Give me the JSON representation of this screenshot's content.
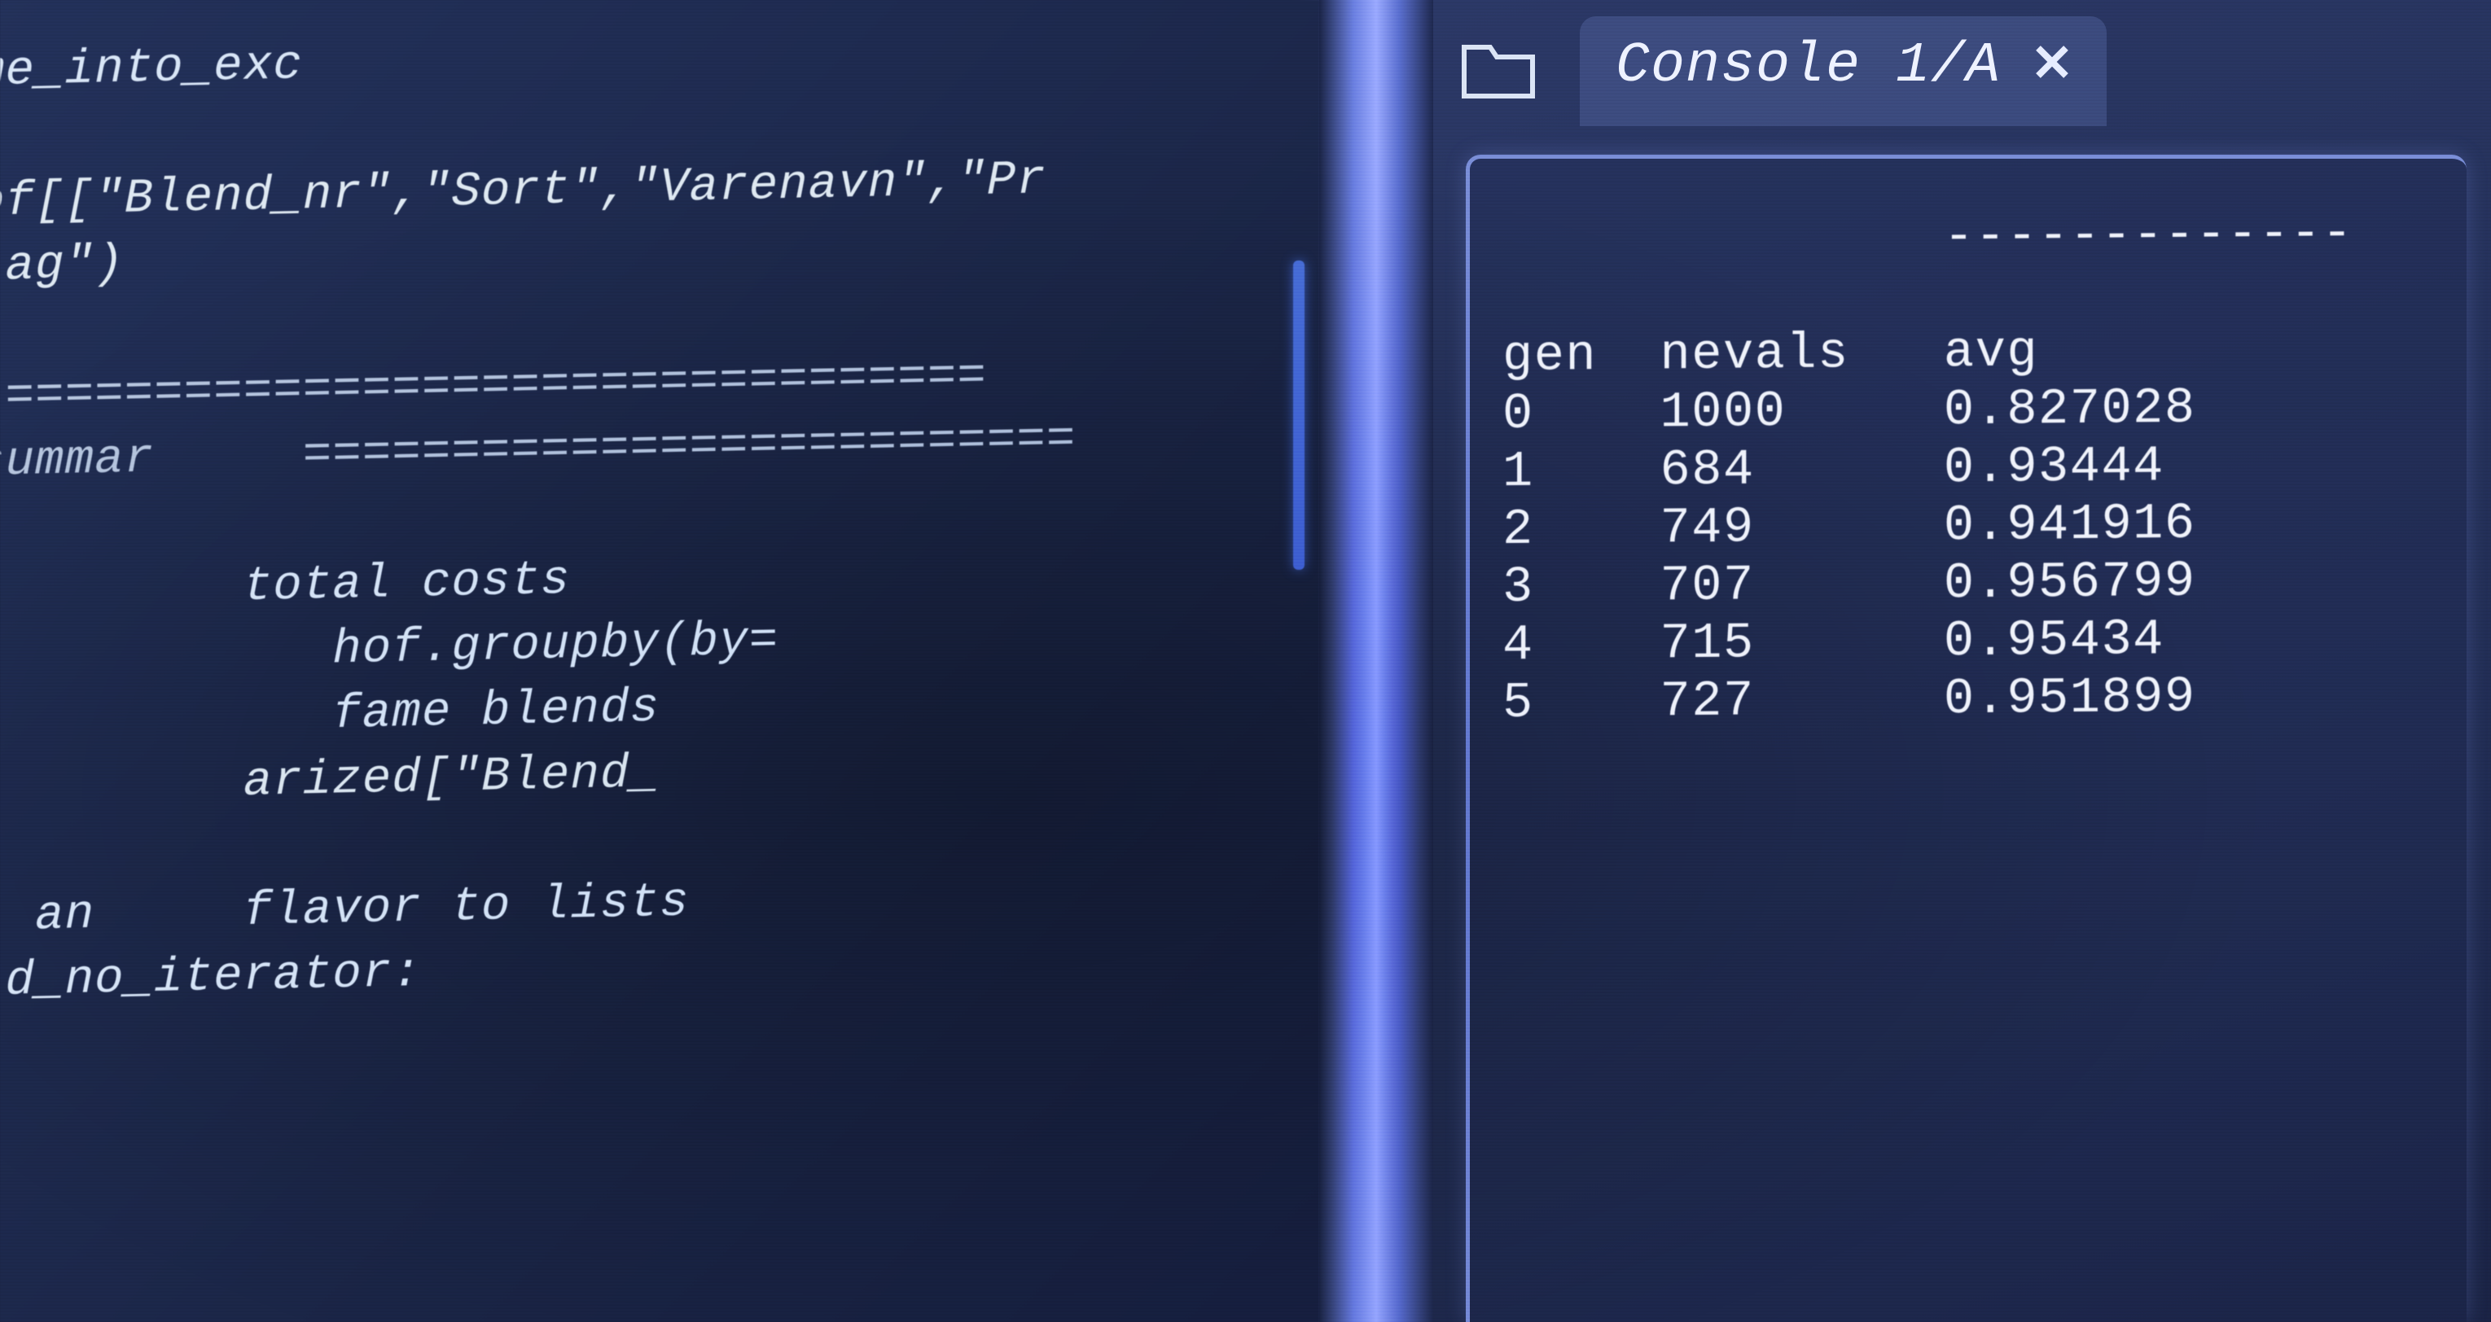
{
  "editor": {
    "lines": [
      "me_into_exc",
      "",
      "of[[\"Blend_nr\",\"Sort\",\"Varenavn\",\"Pr",
      "lag\")",
      "",
      " =================================",
      "summar     ==========================",
      "",
      "         total costs",
      "            hof.groupby(by=",
      "            fame blends",
      "         arized[\"Blend_",
      "",
      "  an     flavor to lists",
      " d_no_iterator:"
    ]
  },
  "console": {
    "tab_label": "Console 1/A",
    "dashes": "-------------",
    "headers": [
      "gen",
      "nevals",
      "avg"
    ],
    "rows": [
      {
        "gen": "0",
        "nevals": "1000",
        "avg": "0.827028"
      },
      {
        "gen": "1",
        "nevals": "684",
        "avg": "0.93444"
      },
      {
        "gen": "2",
        "nevals": "749",
        "avg": "0.941916"
      },
      {
        "gen": "3",
        "nevals": "707",
        "avg": "0.956799"
      },
      {
        "gen": "4",
        "nevals": "715",
        "avg": "0.95434"
      },
      {
        "gen": "5",
        "nevals": "727",
        "avg": "0.951899"
      }
    ]
  }
}
